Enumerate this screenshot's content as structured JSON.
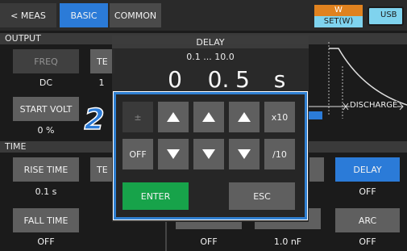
{
  "topbar": {
    "meas": "< MEAS",
    "basic": "BASIC",
    "common": "COMMON",
    "mode_top": "W",
    "mode_bottom": "SET(W)",
    "usb": "USB"
  },
  "output": {
    "section_label": "OUTPUT",
    "freq_label": "FREQ",
    "freq_value": "DC",
    "te_label": "TE",
    "te_value": "1",
    "start_volt_label": "START VOLT",
    "start_volt_value": "0 %"
  },
  "graph": {
    "discharge_label": "DISCHARGE"
  },
  "time": {
    "section_label": "TIME",
    "rise_time_label": "RISE TIME",
    "rise_time_value": "0.1 s",
    "te_label": "TE",
    "fall_time_label": "FALL TIME",
    "fall_time_value": "OFF",
    "delay_label": "DELAY",
    "delay_value": "OFF",
    "arc_label": "ARC",
    "arc_value": "OFF",
    "off_value": "OFF",
    "cap_value": "1.0 nF"
  },
  "dialog": {
    "title": "DELAY",
    "range": "0.1 ... 10.0",
    "digit1": "0",
    "digit2": "0.",
    "digit3": "5",
    "unit": "s",
    "sign": "±",
    "off": "OFF",
    "x10": "x10",
    "div10": "/10",
    "enter": "ENTER",
    "esc": "ESC"
  },
  "callout": "2",
  "colors": {
    "accent_blue": "#2b7bd8",
    "highlight_border": "#2f7fd1",
    "enter_green": "#17a34a"
  }
}
